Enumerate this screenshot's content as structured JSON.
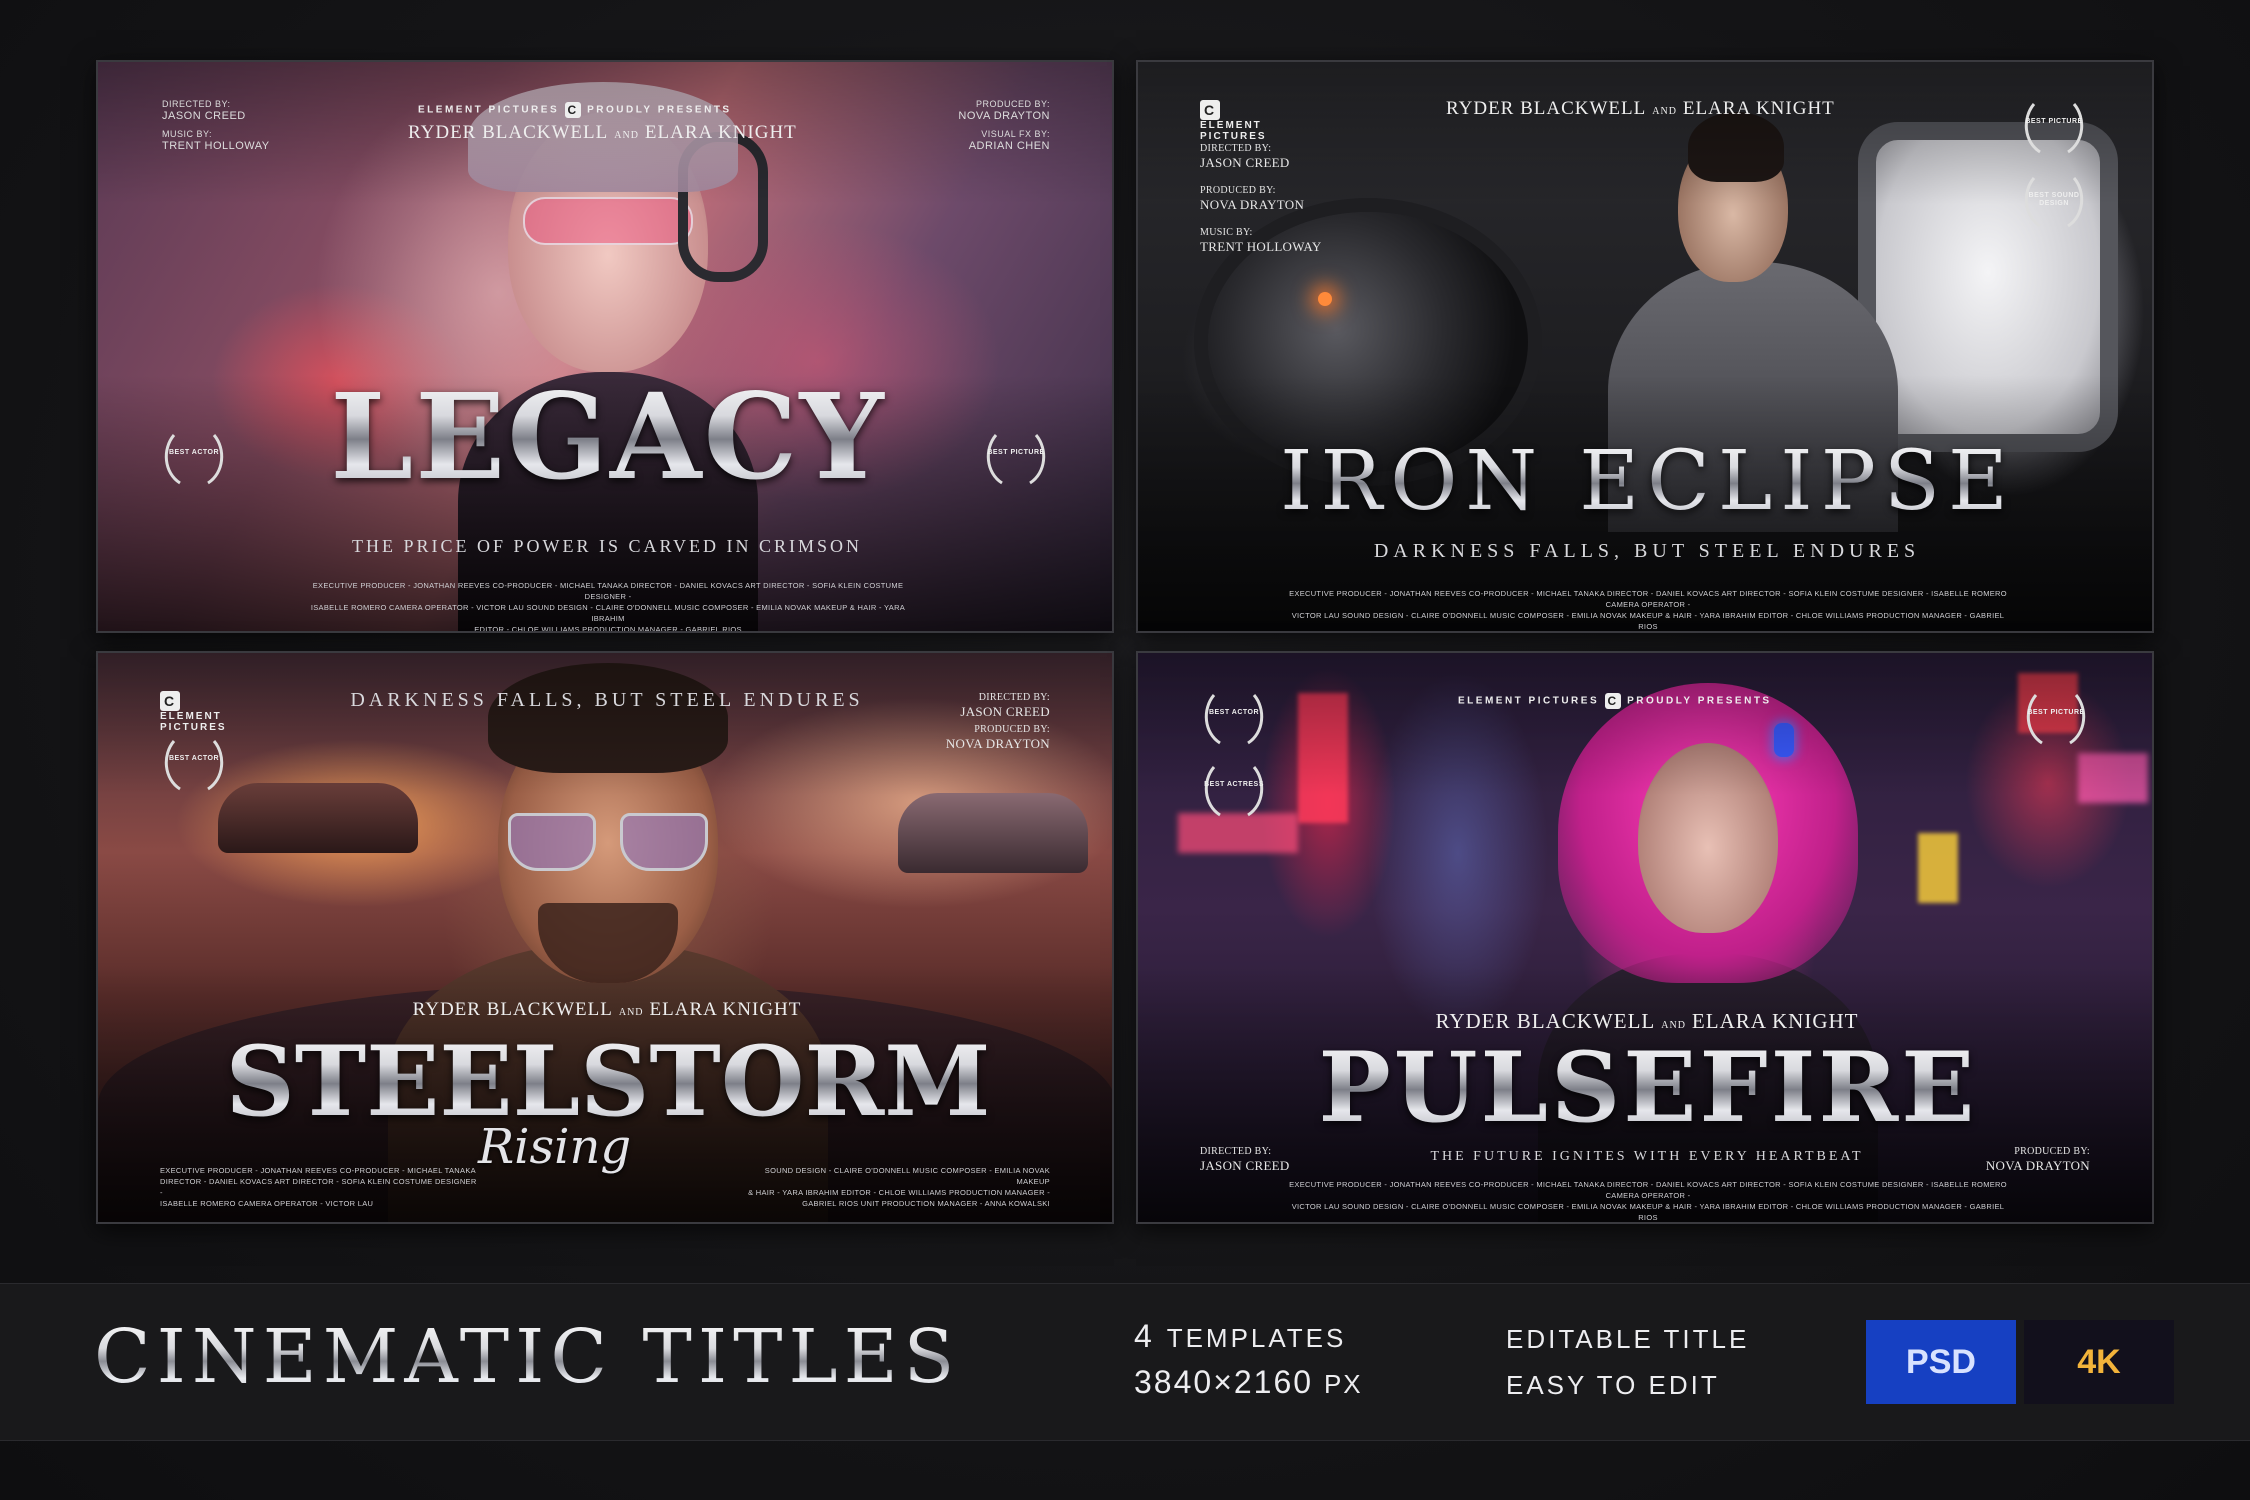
{
  "posters": {
    "legacy": {
      "presents_left": "ELEMENT PICTURES",
      "presents_right": "PROUDLY PRESENTS",
      "cast_1": "RYDER BLACKWELL",
      "cast_and": "AND",
      "cast_2": "ELARA KNIGHT",
      "directed_label": "DIRECTED BY:",
      "directed_name": "JASON CREED",
      "music_label": "MUSIC BY:",
      "music_name": "TRENT HOLLOWAY",
      "produced_label": "PRODUCED BY:",
      "produced_name": "NOVA DRAYTON",
      "vfx_label": "VISUAL FX BY:",
      "vfx_name": "ADRIAN CHEN",
      "award_left": "BEST ACTOR",
      "award_right": "BEST PICTURE",
      "title": "LEGACY",
      "tagline": "THE PRICE OF POWER IS CARVED IN CRIMSON",
      "credits_1": "EXECUTIVE PRODUCER - JONATHAN REEVES    CO-PRODUCER - MICHAEL TANAKA    DIRECTOR - DANIEL KOVACS    ART DIRECTOR - SOFIA KLEIN    COSTUME DESIGNER -",
      "credits_2": "ISABELLE ROMERO    CAMERA OPERATOR - VICTOR LAU    SOUND DESIGN - CLAIRE O'DONNELL    MUSIC COMPOSER - EMILIA NOVAK    MAKEUP & HAIR - YARA IBRAHIM",
      "credits_3": "EDITOR - CHLOE WILLIAMS    PRODUCTION MANAGER - GABRIEL RIOS"
    },
    "iron_eclipse": {
      "brand_1": "ELEMENT",
      "brand_2": "PICTURES",
      "cast_1": "RYDER BLACKWELL",
      "cast_and": "AND",
      "cast_2": "ELARA KNIGHT",
      "directed_label": "DIRECTED BY:",
      "directed_name": "JASON CREED",
      "produced_label": "PRODUCED BY:",
      "produced_name": "NOVA DRAYTON",
      "music_label": "MUSIC BY:",
      "music_name": "TRENT HOLLOWAY",
      "award_1": "BEST PICTURE",
      "award_2": "BEST SOUND DESIGN",
      "title": "IRON ECLIPSE",
      "tagline": "DARKNESS FALLS, BUT STEEL ENDURES",
      "credits_1": "EXECUTIVE PRODUCER - JONATHAN REEVES    CO-PRODUCER - MICHAEL TANAKA    DIRECTOR - DANIEL KOVACS    ART DIRECTOR - SOFIA KLEIN    COSTUME DESIGNER - ISABELLE ROMERO    CAMERA OPERATOR -",
      "credits_2": "VICTOR LAU    SOUND DESIGN - CLAIRE O'DONNELL    MUSIC COMPOSER - EMILIA NOVAK    MAKEUP & HAIR - YARA IBRAHIM    EDITOR - CHLOE WILLIAMS    PRODUCTION MANAGER - GABRIEL RIOS"
    },
    "steelstorm": {
      "brand_1": "ELEMENT",
      "brand_2": "PICTURES",
      "tagline": "DARKNESS FALLS, BUT STEEL ENDURES",
      "directed_label": "DIRECTED BY:",
      "directed_name": "JASON CREED",
      "produced_label": "PRODUCED BY:",
      "produced_name": "NOVA DRAYTON",
      "award": "BEST ACTOR",
      "cast_1": "RYDER BLACKWELL",
      "cast_and": "AND",
      "cast_2": "ELARA KNIGHT",
      "title": "STEELSTORM",
      "subtitle": "Rising",
      "credits_left_1": "EXECUTIVE PRODUCER - JONATHAN REEVES    CO-PRODUCER - MICHAEL TANAKA",
      "credits_left_2": "DIRECTOR - DANIEL KOVACS    ART DIRECTOR - SOFIA KLEIN    COSTUME DESIGNER -",
      "credits_left_3": "ISABELLE ROMERO    CAMERA OPERATOR - VICTOR LAU",
      "credits_right_1": "SOUND DESIGN - CLAIRE O'DONNELL    MUSIC COMPOSER - EMILIA NOVAK    MAKEUP",
      "credits_right_2": "& HAIR - YARA IBRAHIM    EDITOR - CHLOE WILLIAMS    PRODUCTION MANAGER -",
      "credits_right_3": "GABRIEL RIOS    UNIT PRODUCTION MANAGER - ANNA KOWALSKI"
    },
    "pulsefire": {
      "presents_left": "ELEMENT PICTURES",
      "presents_right": "PROUDLY PRESENTS",
      "award_1": "BEST ACTOR",
      "award_2": "BEST ACTRESS",
      "award_3": "BEST PICTURE",
      "cast_1": "RYDER BLACKWELL",
      "cast_and": "AND",
      "cast_2": "ELARA KNIGHT",
      "title": "PULSEFIRE",
      "tagline": "THE FUTURE IGNITES WITH EVERY HEARTBEAT",
      "directed_label": "DIRECTED BY:",
      "directed_name": "JASON CREED",
      "produced_label": "PRODUCED BY:",
      "produced_name": "NOVA DRAYTON",
      "credits_1": "EXECUTIVE PRODUCER - JONATHAN REEVES    CO-PRODUCER - MICHAEL TANAKA    DIRECTOR - DANIEL KOVACS    ART DIRECTOR - SOFIA KLEIN    COSTUME DESIGNER - ISABELLE ROMERO    CAMERA OPERATOR -",
      "credits_2": "VICTOR LAU    SOUND DESIGN - CLAIRE O'DONNELL    MUSIC COMPOSER - EMILIA NOVAK    MAKEUP & HAIR - YARA IBRAHIM    EDITOR - CHLOE WILLIAMS    PRODUCTION MANAGER - GABRIEL RIOS"
    }
  },
  "footer": {
    "title": "CINEMATIC TITLES",
    "spec_count": "4",
    "spec_templates": "TEMPLATES",
    "spec_resolution": "3840×2160",
    "spec_px": "PX",
    "feature_1": "EDITABLE TITLE",
    "feature_2": "EASY TO EDIT",
    "badge_psd": "PSD",
    "badge_4k": "4K"
  },
  "colors": {
    "psd_badge_bg": "#1640c2",
    "psd_badge_text": "#d8e2ff",
    "k4_badge_bg": "#12101c",
    "k4_badge_text": "#f2b33a"
  }
}
